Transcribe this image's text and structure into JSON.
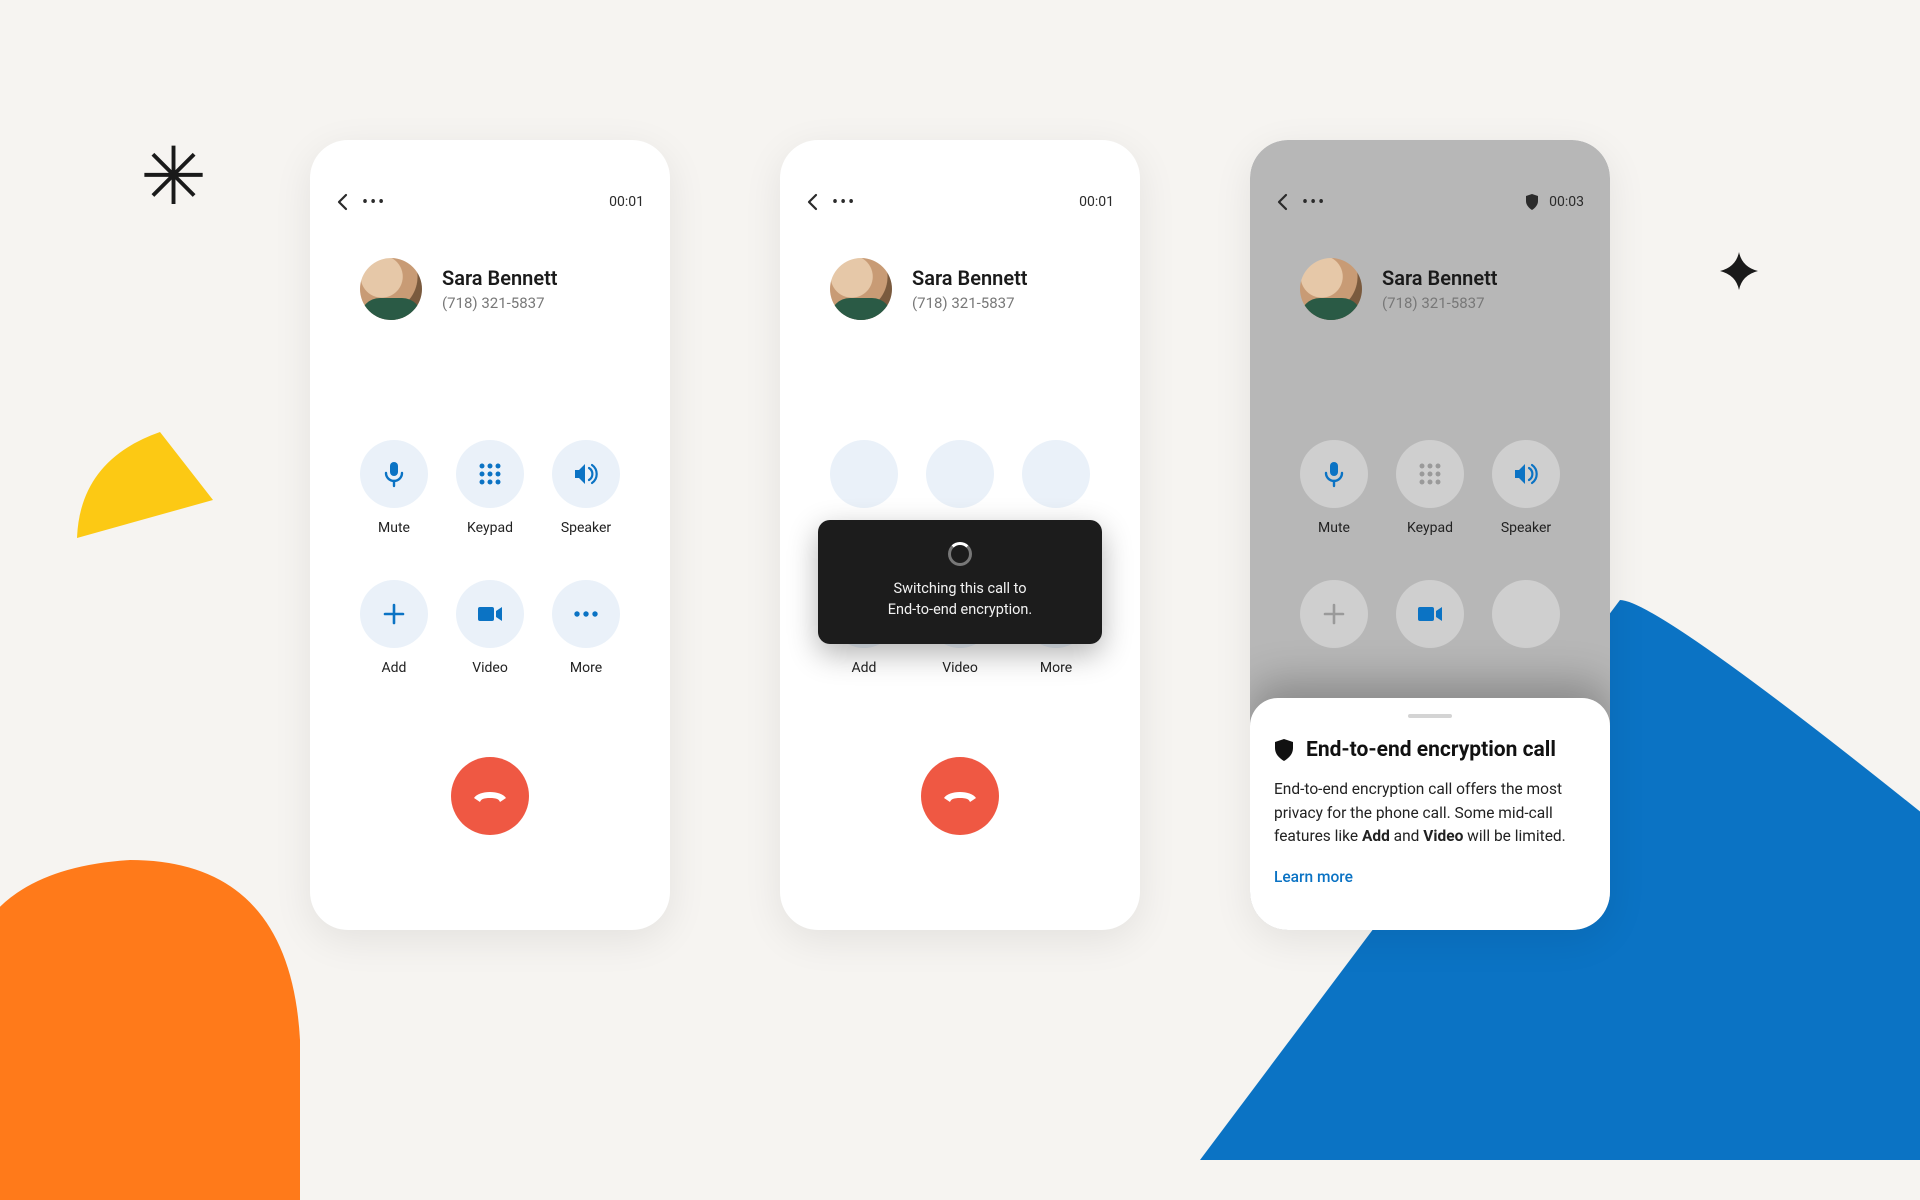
{
  "caller": {
    "name": "Sara Bennett",
    "phone": "(718) 321-5837"
  },
  "screens": [
    {
      "timer": "00:01",
      "show_shield": false
    },
    {
      "timer": "00:01",
      "show_shield": false
    },
    {
      "timer": "00:03",
      "show_shield": true
    }
  ],
  "buttons": {
    "mute": "Mute",
    "keypad": "Keypad",
    "speaker": "Speaker",
    "add": "Add",
    "video": "Video",
    "more": "More"
  },
  "toast": {
    "line1": "Switching this call to",
    "line2": "End-to-end encryption."
  },
  "sheet": {
    "title": "End-to-end encryption call",
    "body_pre": "End-to-end encryption call offers the most privacy for the phone call. Some mid-call features like ",
    "body_b1": "Add",
    "body_mid": " and ",
    "body_b2": "Video",
    "body_post": " will be limited.",
    "link": "Learn more"
  }
}
